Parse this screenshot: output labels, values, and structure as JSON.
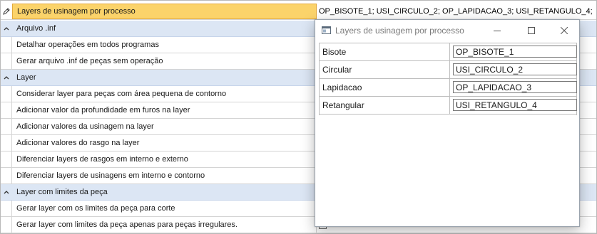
{
  "grid": {
    "selected_row": {
      "label": "Layers de usinagem por processo",
      "value": "OP_BISOTE_1; USI_CIRCULO_2; OP_LAPIDACAO_3; USI_RETANGULO_4;",
      "icon": "pencil-icon"
    },
    "categories": [
      {
        "label": "Arquivo .inf",
        "items": [
          "Detalhar operações em todos programas",
          "Gerar arquivo .inf de peças sem operação"
        ]
      },
      {
        "label": "Layer",
        "items": [
          "Considerar layer para peças com área pequena de contorno",
          "Adicionar valor da profundidade em furos na layer",
          "Adicionar valores da usinagem na layer",
          "Adicionar valores do rasgo na layer",
          "Diferenciar layers de rasgos em interno e externo",
          "Diferenciar layers de usinagens em interno e contorno"
        ]
      },
      {
        "label": "Layer com limites da peça",
        "items": [
          "Gerar layer com os limites da peça para corte",
          "Gerar layer com limites da peça apenas para peças irregulares."
        ]
      }
    ]
  },
  "dialog": {
    "title": "Layers de usinagem por processo",
    "rows": [
      {
        "label": "Bisote",
        "value": "OP_BISOTE_1"
      },
      {
        "label": "Circular",
        "value": "USI_CIRCULO_2"
      },
      {
        "label": "Lapidacao",
        "value": "OP_LAPIDACAO_3"
      },
      {
        "label": "Retangular",
        "value": "USI_RETANGULO_4"
      }
    ]
  }
}
